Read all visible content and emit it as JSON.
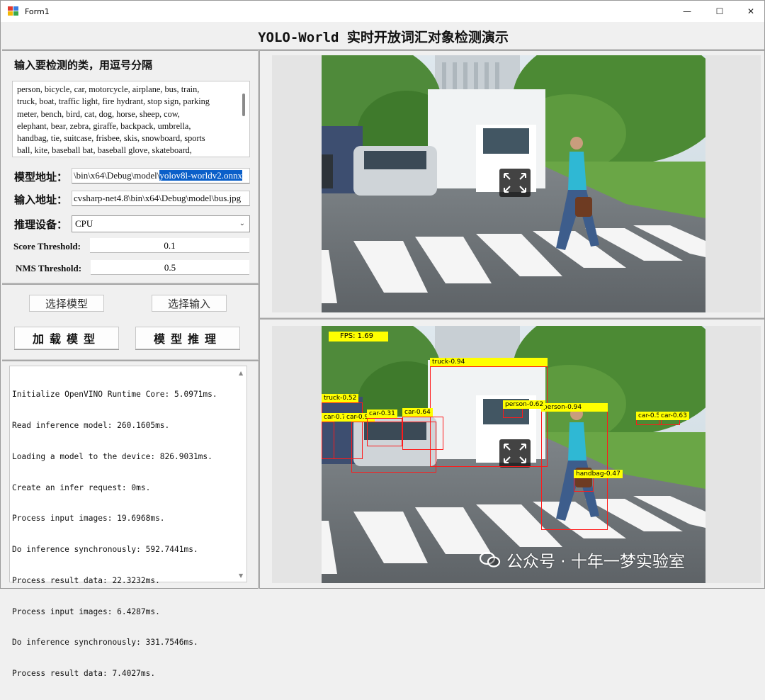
{
  "window": {
    "title": "Form1",
    "minimize": "—",
    "maximize": "☐",
    "close": "✕"
  },
  "header": {
    "title": "YOLO-World 实时开放词汇对象检测演示"
  },
  "left": {
    "classes_label": "输入要检测的类，用逗号分隔",
    "classes_lines": [
      "person, bicycle, car, motorcycle, airplane, bus, train,",
      "truck, boat, traffic light, fire hydrant, stop sign, parking",
      "meter, bench, bird, cat, dog, horse, sheep, cow,",
      "elephant, bear, zebra, giraffe, backpack, umbrella,",
      "handbag, tie, suitcase, frisbee, skis, snowboard, sports",
      "ball, kite, baseball bat, baseball glove, skateboard,"
    ],
    "model_label": "模型地址：",
    "model_path_prefix": "\\bin\\x64\\Debug\\model\\",
    "model_path_selected": "yolov8l-worldv2.onnx",
    "input_label": "输入地址：",
    "input_path": "cvsharp-net4.8\\bin\\x64\\Debug\\model\\bus.jpg",
    "device_label": "推理设备：",
    "device_value": "CPU",
    "score_label": "Score Threshold:",
    "score_value": "0.1",
    "nms_label": "NMS Threshold:",
    "nms_value": "0.5",
    "btn_select_model": "选择模型",
    "btn_select_input": "选择输入",
    "btn_load_model": "加载模型",
    "btn_infer": "模型推理",
    "log_lines": [
      "Initialize OpenVINO Runtime Core: 5.0971ms.",
      "Read inference model: 260.1605ms.",
      "Loading a model to the device: 826.9031ms.",
      "Create an infer request: 0ms.",
      "Process input images: 19.6968ms.",
      "Do inference synchronously: 592.7441ms.",
      "Process result data: 22.3232ms.",
      "Process input images: 6.4287ms.",
      "Do inference synchronously: 331.7546ms.",
      "Process result data: 7.4027ms."
    ]
  },
  "result": {
    "fps": "FPS: 1.69",
    "detections": [
      {
        "label": "truck-0.94"
      },
      {
        "label": "truck-0.52"
      },
      {
        "label": "car-0.77"
      },
      {
        "label": "car-0.92"
      },
      {
        "label": "car-0.31"
      },
      {
        "label": "car-0.64"
      },
      {
        "label": "person-0.94"
      },
      {
        "label": "person-0.62"
      },
      {
        "label": "car-0.57"
      },
      {
        "label": "car-0.63"
      },
      {
        "label": "handbag-0.47"
      }
    ]
  },
  "watermark": "公众号 · 十年一梦实验室",
  "colors": {
    "detection_box": "#ff1a1a",
    "detection_label_bg": "#ffff00",
    "selection": "#0a5fc9"
  }
}
